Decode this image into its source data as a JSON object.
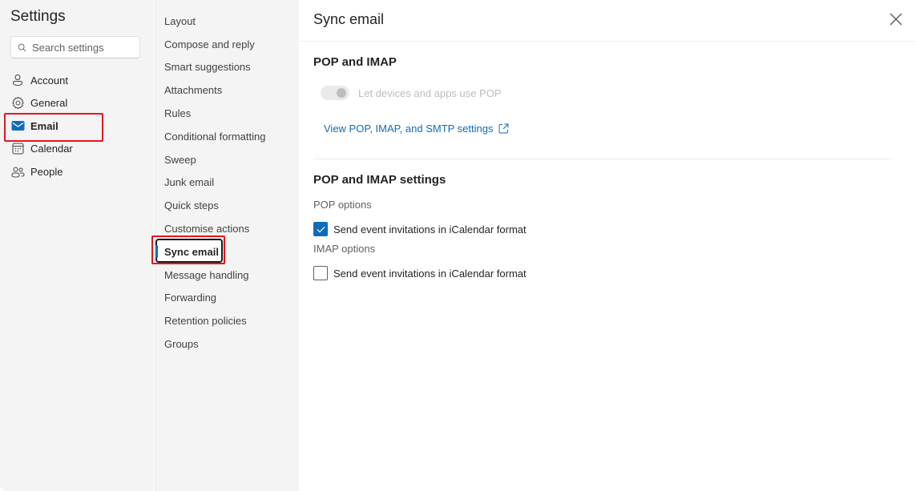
{
  "leftnav": {
    "title": "Settings",
    "search_placeholder": "Search settings",
    "search_value": "",
    "items": [
      {
        "label": "Account",
        "icon": "person-icon"
      },
      {
        "label": "General",
        "icon": "gear-icon"
      },
      {
        "label": "Email",
        "icon": "mail-icon",
        "selected": true
      },
      {
        "label": "Calendar",
        "icon": "calendar-icon"
      },
      {
        "label": "People",
        "icon": "people-icon"
      }
    ]
  },
  "subnav": {
    "items": [
      {
        "label": "Layout"
      },
      {
        "label": "Compose and reply"
      },
      {
        "label": "Smart suggestions"
      },
      {
        "label": "Attachments"
      },
      {
        "label": "Rules"
      },
      {
        "label": "Conditional formatting"
      },
      {
        "label": "Sweep"
      },
      {
        "label": "Junk email"
      },
      {
        "label": "Quick steps"
      },
      {
        "label": "Customise actions"
      },
      {
        "label": "Sync email",
        "selected": true
      },
      {
        "label": "Message handling"
      },
      {
        "label": "Forwarding"
      },
      {
        "label": "Retention policies"
      },
      {
        "label": "Groups"
      }
    ]
  },
  "content": {
    "title": "Sync email",
    "close_icon": "close-icon",
    "pop_imap": {
      "heading": "POP and IMAP",
      "toggle_label": "Let devices and apps use POP",
      "toggle_on": true,
      "toggle_disabled": true,
      "link_label": "View POP, IMAP, and SMTP settings",
      "link_icon": "open-external-icon"
    },
    "pop_imap_settings": {
      "heading": "POP and IMAP settings",
      "pop_options_label": "POP options",
      "pop_checkbox_label": "Send event invitations in iCalendar format",
      "pop_checkbox_checked": true,
      "imap_options_label": "IMAP options",
      "imap_checkbox_label": "Send event invitations in iCalendar format",
      "imap_checkbox_checked": false
    }
  },
  "colors": {
    "accent": "#0f6cbd",
    "highlight_box": "#e8141c",
    "nav_background": "#f4f4f4"
  }
}
